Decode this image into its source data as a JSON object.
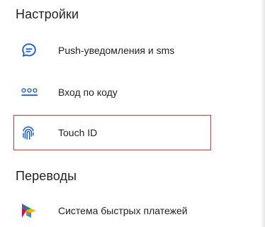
{
  "sections": [
    {
      "title": "Настройки",
      "items": [
        {
          "label": "Push-уведомления и sms",
          "icon": "chat-bubble-icon"
        },
        {
          "label": "Вход по коду",
          "icon": "passcode-dots-icon"
        },
        {
          "label": "Touch ID",
          "icon": "fingerprint-icon"
        }
      ]
    },
    {
      "title": "Переводы",
      "items": [
        {
          "label": "Система быстрых платежей",
          "icon": "sbp-logo-icon"
        }
      ]
    }
  ],
  "colors": {
    "accent": "#1f5fd6",
    "highlight_border": "#e0323e",
    "text": "#222222"
  }
}
